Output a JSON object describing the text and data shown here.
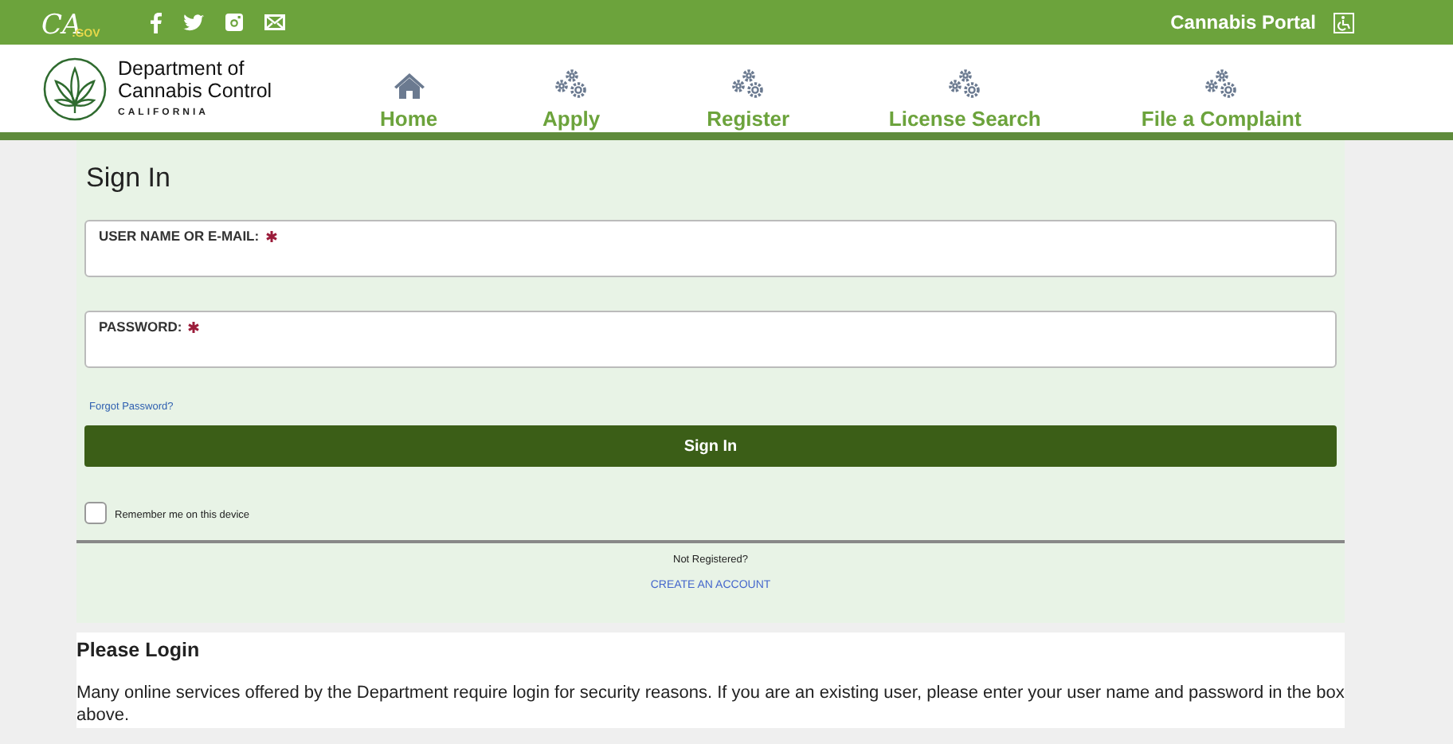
{
  "top_bar": {
    "logo": {
      "main": "CA",
      "sub": ".GOV"
    },
    "social": [
      {
        "kind": "facebook"
      },
      {
        "kind": "twitter"
      },
      {
        "kind": "instagram"
      },
      {
        "kind": "email"
      }
    ],
    "portal_link": "Cannabis Portal"
  },
  "header": {
    "org_name": [
      "Department of",
      "Cannabis Control"
    ],
    "org_state": "CALIFORNIA",
    "nav": [
      {
        "label": "Home",
        "kind": "home"
      },
      {
        "label": "Apply",
        "kind": "gears"
      },
      {
        "label": "Register",
        "kind": "gears"
      },
      {
        "label": "License Search",
        "kind": "gears"
      },
      {
        "label": "File a Complaint",
        "kind": "gears"
      }
    ]
  },
  "sign_in": {
    "title": "Sign In",
    "fields": [
      {
        "label": "USER NAME OR E-MAIL:",
        "required": true
      },
      {
        "label": "PASSWORD:",
        "required": true
      }
    ],
    "forgot_link": "Forgot Password?",
    "button": "Sign In",
    "remember": {
      "label": "Remember me on this device",
      "checked": false
    },
    "not_registered": "Not Registered?",
    "create_link": "CREATE AN ACCOUNT"
  },
  "info": {
    "title": "Please Login",
    "text": "Many online services offered by the Department require login for security reasons. If you are an existing user, please enter your user name and password in the box above."
  }
}
